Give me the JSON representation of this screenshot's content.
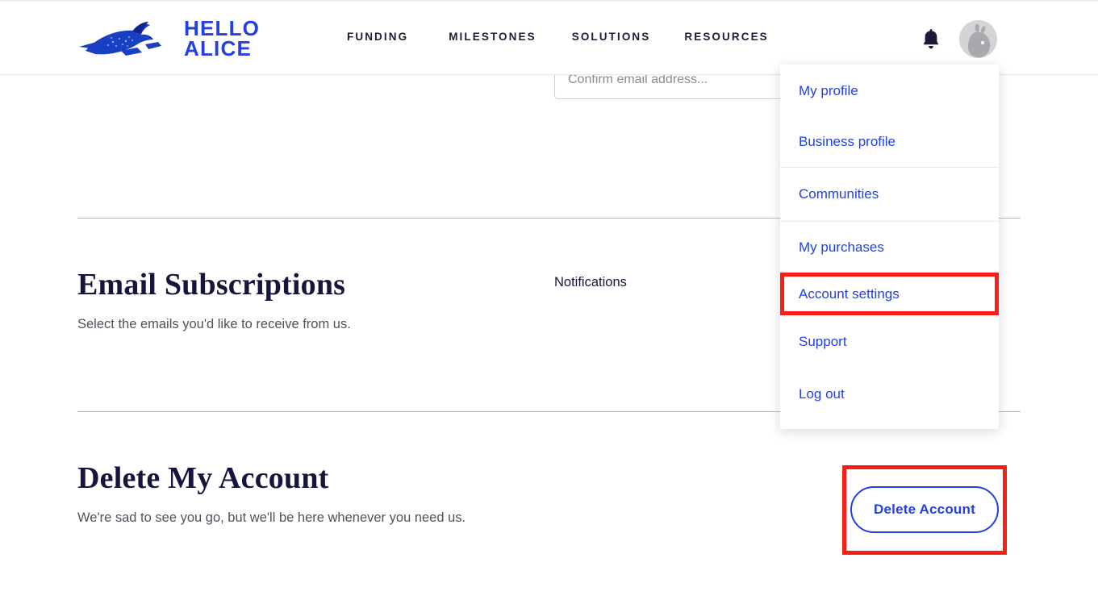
{
  "header": {
    "logo": {
      "icon": "running-rabbit-logo-icon",
      "line1": "HELLO",
      "line2": "ALICE",
      "color": "#2440E0"
    },
    "nav": [
      {
        "label": "FUNDING"
      },
      {
        "label": "MILESTONES"
      },
      {
        "label": "SOLUTIONS"
      },
      {
        "label": "RESOURCES"
      }
    ],
    "notifications_icon": "bell-icon",
    "avatar_icon": "rabbit-avatar-icon"
  },
  "main": {
    "email_input": {
      "placeholder": "Confirm email address...",
      "value": ""
    },
    "notifications_label": "Notifications",
    "email_section": {
      "title": "Email Subscriptions",
      "subtitle": "Select the emails you'd like to receive from us."
    },
    "delete_section": {
      "title": "Delete My Account",
      "subtitle": "We're sad to see you go, but we'll be here whenever you need us.",
      "button_label": "Delete Account"
    }
  },
  "account_menu": {
    "items": [
      {
        "label": "My profile",
        "highlighted": false
      },
      {
        "label": "Business profile",
        "highlighted": false
      },
      {
        "label": "Communities",
        "highlighted": false
      },
      {
        "label": "My purchases",
        "highlighted": false
      },
      {
        "label": "Account settings",
        "highlighted": true
      },
      {
        "label": "Support",
        "highlighted": false
      },
      {
        "label": "Log out",
        "highlighted": false
      }
    ]
  },
  "colors": {
    "brand_blue": "#2440E0",
    "dark_navy": "#16163c",
    "highlight_red": "#f91e18",
    "muted_text": "#51515e"
  }
}
